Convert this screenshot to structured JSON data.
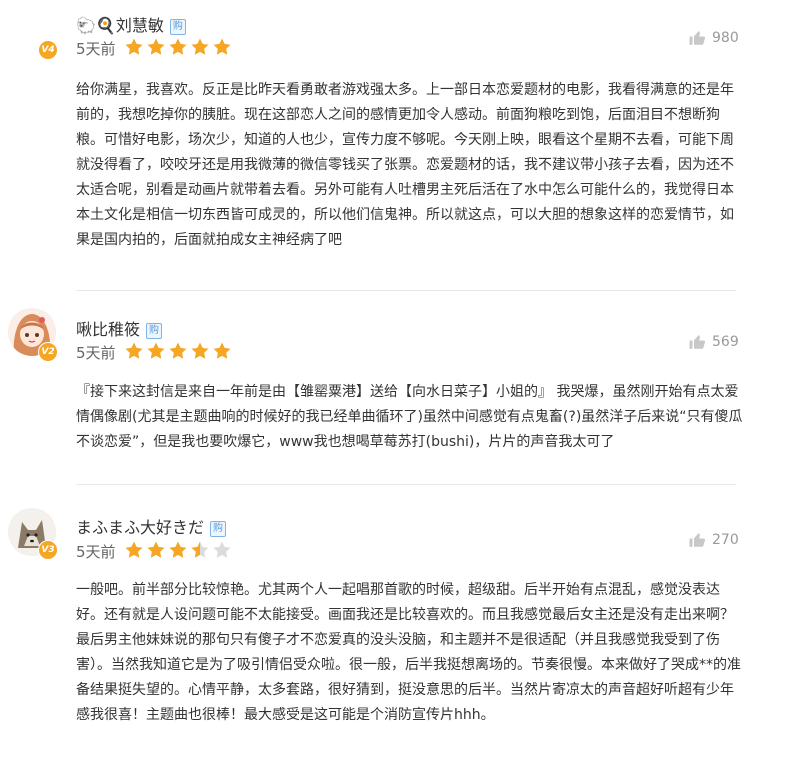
{
  "colors": {
    "star_full": "#f5a623",
    "star_empty": "#dcdcdc",
    "badge": "#f5a623"
  },
  "icons": {
    "buy": "buy-badge-icon",
    "like": "thumbs-up-icon",
    "star": "star-icon"
  },
  "reviews": [
    {
      "name": "🐑🍳刘慧敏",
      "level": "V4",
      "time": "5天前",
      "rating": 5,
      "likes": "980",
      "text": "给你满星，我喜欢。反正是比昨天看勇敢者游戏强太多。上一部日本恋爱题材的电影，我看得满意的还是年前的，我想吃掉你的胰脏。现在这部恋人之间的感情更加令人感动。前面狗粮吃到饱，后面泪目不想断狗粮。可惜好电影，场次少，知道的人也少，宣传力度不够呢。今天刚上映，眼看这个星期不去看，可能下周就没得看了，咬咬牙还是用我微薄的微信零钱买了张票。恋爱题材的话，我不建议带小孩子去看，因为还不太适合呢，别看是动画片就带着去看。另外可能有人吐槽男主死后活在了水中怎么可能什么的，我觉得日本本土文化是相信一切东西皆可成灵的，所以他们信鬼神。所以就这点，可以大胆的想象这样的恋爱情节，如果是国内拍的，后面就拍成女主神经病了吧"
    },
    {
      "name": "啾比稚筱",
      "level": "V2",
      "time": "5天前",
      "rating": 5,
      "likes": "569",
      "text": "『接下来这封信是来自一年前是由【雏罂粟港】送给【向水日菜子】小姐的』 我哭爆，虽然刚开始有点太爱情偶像剧(尤其是主题曲响的时候好的我已经单曲循环了)虽然中间感觉有点鬼畜(?)虽然洋子后来说“只有傻瓜不谈恋爱”，但是我也要吹爆它，www我也想喝草莓苏打(bushi)，片片的声音我太可了"
    },
    {
      "name": "まふまふ大好きだ",
      "level": "V3",
      "time": "5天前",
      "rating": 3.5,
      "likes": "270",
      "text": "一般吧。前半部分比较惊艳。尤其两个人一起唱那首歌的时候，超级甜。后半开始有点混乱，感觉没表达好。还有就是人设问题可能不太能接受。画面我还是比较喜欢的。而且我感觉最后女主还是没有走出来啊？最后男主他妹妹说的那句只有傻子才不恋爱真的没头没脑，和主题并不是很适配（并且我感觉我受到了伤害）。当然我知道它是为了吸引情侣受众啦。很一般，后半我挺想离场的。节奏很慢。本来做好了哭成**的准备结果挺失望的。心情平静，太多套路，很好猜到，挺没意思的后半。当然片寄凉太的声音超好听超有少年感我很喜！主题曲也很棒！最大感受是这可能是个消防宣传片hhh。"
    }
  ]
}
